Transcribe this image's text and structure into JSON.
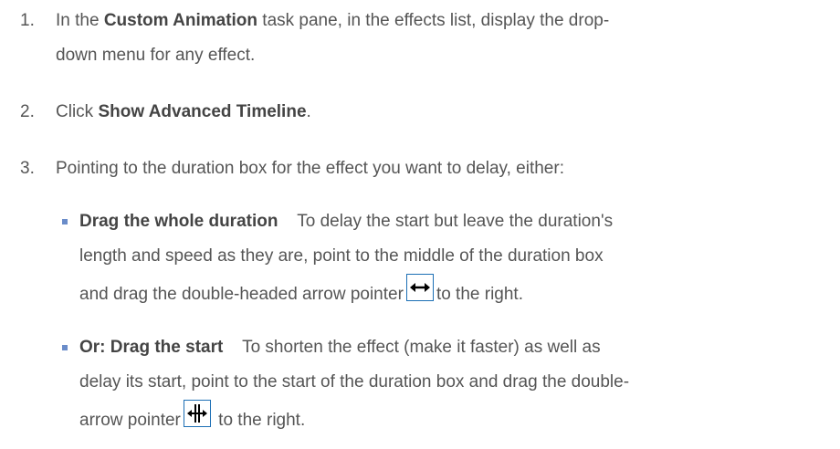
{
  "steps": [
    {
      "number": "1.",
      "pre": "In the ",
      "bold": "Custom Animation",
      "line1_rest": " task pane, in the effects list, display the drop-",
      "line2": "down menu for any effect."
    },
    {
      "number": "2.",
      "pre": "Click ",
      "bold": "Show Advanced Timeline",
      "post": "."
    },
    {
      "number": "3.",
      "text": "Pointing to the duration box for the effect you want to delay, either:"
    }
  ],
  "options": [
    {
      "title": "Drag the whole duration",
      "line1": "    To delay the start but leave the duration's",
      "line2": "length and speed as they are, point to the middle of the duration box",
      "line3_pre": "and drag the double-headed arrow pointer",
      "line3_post": "to the right.",
      "icon": "double-headed-arrow-icon"
    },
    {
      "title": "Or: Drag the start",
      "line1": "    To shorten the effect (make it faster) as well as",
      "line2": "delay its start, point to the start of the duration box and drag the double-",
      "line3_pre": "arrow pointer",
      "line3_post": " to the right.",
      "icon": "resize-arrow-icon"
    }
  ],
  "colors": {
    "text": "#555555",
    "bullet": "#6a8cc9",
    "icon_border": "#1c6fb5"
  }
}
